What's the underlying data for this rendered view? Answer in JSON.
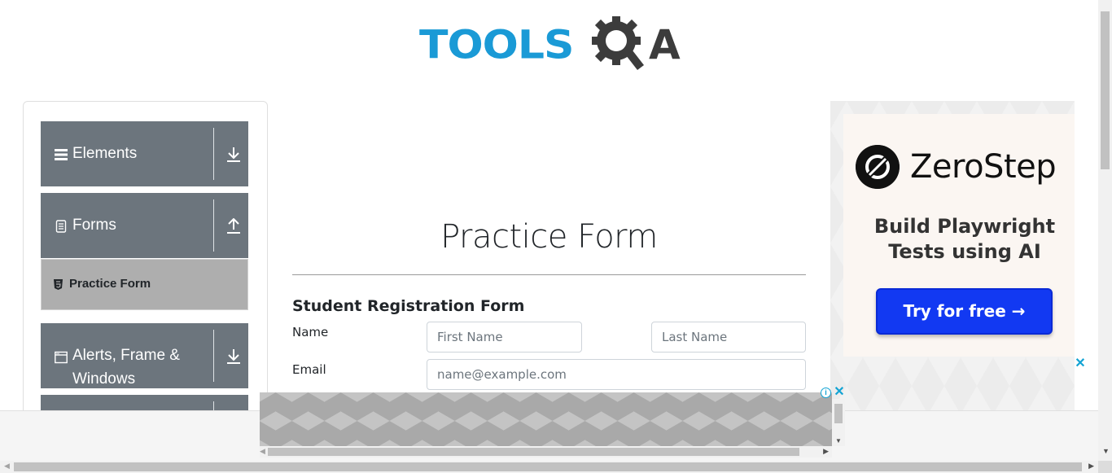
{
  "header": {
    "logo_text": "TOOLS",
    "logo_suffix": "A"
  },
  "sidebar": {
    "groups": [
      {
        "label": "Elements",
        "icon": "hamburger-icon",
        "expanded": false
      },
      {
        "label": "Forms",
        "icon": "document-icon",
        "expanded": true,
        "items": [
          {
            "label": "Practice Form",
            "icon": "html5-icon",
            "active": true
          }
        ]
      },
      {
        "label": "Alerts, Frame &",
        "label_line2": "Windows",
        "icon": "window-icon",
        "expanded": false
      }
    ]
  },
  "main": {
    "title": "Practice Form",
    "form_heading": "Student Registration Form",
    "fields": {
      "name_label": "Name",
      "first_name_placeholder": "First Name",
      "last_name_placeholder": "Last Name",
      "email_label": "Email",
      "email_placeholder": "name@example.com"
    }
  },
  "ad_right": {
    "brand": "ZeroStep",
    "headline_line1": "Build Playwright",
    "headline_line2": "Tests using AI",
    "cta": "Try for free →",
    "close": "✕"
  },
  "ad_bottom": {
    "info": "i",
    "close": "✕"
  },
  "colors": {
    "logo_blue": "#1a9ad6",
    "logo_dark": "#3c3c3c",
    "sidebar_header": "#6c757d",
    "sidebar_active": "#aeaeae",
    "cta_blue": "#1239f2",
    "ad_close": "#12a3d4"
  }
}
